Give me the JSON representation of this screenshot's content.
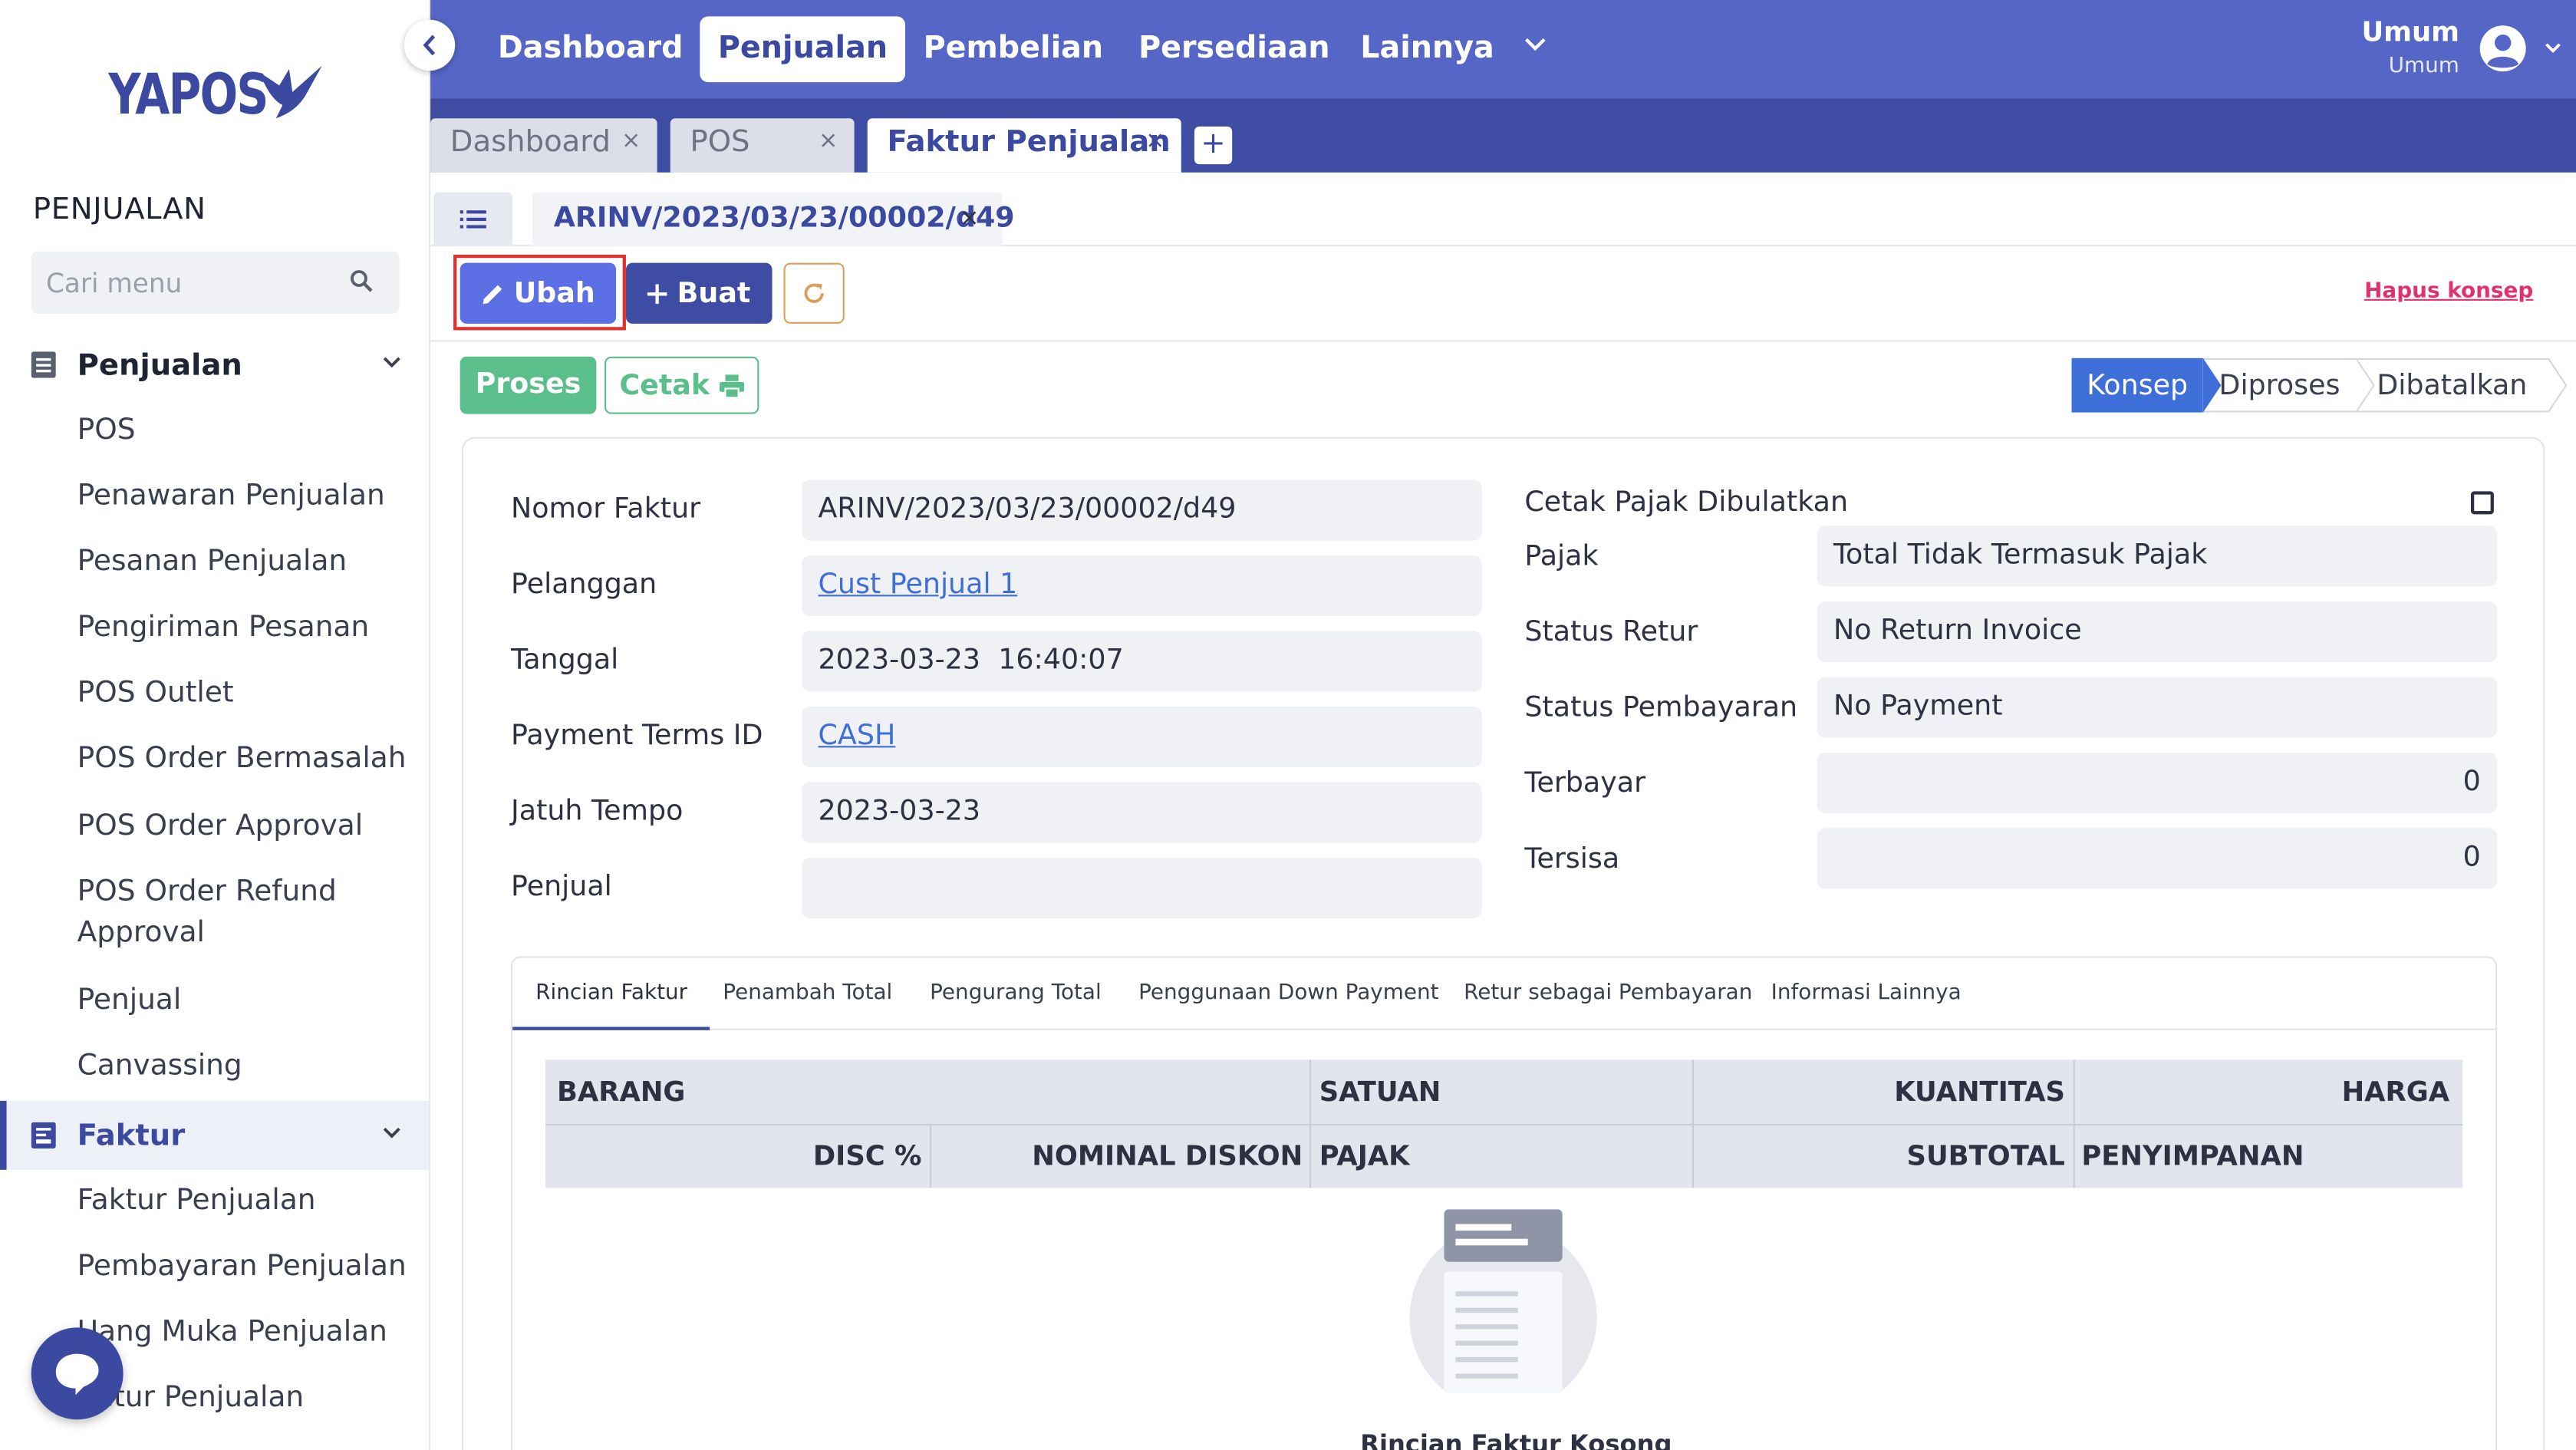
{
  "brand": {
    "name": "YAPOS"
  },
  "sidebar": {
    "section_title": "PENJUALAN",
    "search_placeholder": "Cari menu",
    "groups": [
      {
        "label": "Penjualan",
        "items": [
          "POS",
          "Penawaran Penjualan",
          "Pesanan Penjualan",
          "Pengiriman Pesanan",
          "POS Outlet",
          "POS Order Bermasalah",
          "POS Order Approval",
          "POS Order Refund Approval",
          "Penjual",
          "Canvassing"
        ]
      },
      {
        "label": "Faktur",
        "items": [
          "Faktur Penjualan",
          "Pembayaran Penjualan",
          "Uang Muka Penjualan",
          "Retur Penjualan"
        ]
      }
    ]
  },
  "topnav": {
    "items": [
      "Dashboard",
      "Penjualan",
      "Pembelian",
      "Persediaan",
      "Lainnya"
    ],
    "active": "Penjualan",
    "user": {
      "name": "Umum",
      "role": "Umum"
    }
  },
  "page_tabs": [
    {
      "label": "Dashboard",
      "close": "×"
    },
    {
      "label": "POS",
      "close": "×"
    },
    {
      "label": "Faktur Penjualan",
      "close": "×"
    }
  ],
  "tab_add": "+",
  "doc_tab": {
    "label": "ARINV/2023/03/23/00002/d49",
    "close": "×"
  },
  "toolbar": {
    "edit_label": "Ubah",
    "create_label": "Buat",
    "delete_draft_label": "Hapus konsep"
  },
  "actions": {
    "process_label": "Proses",
    "print_label": "Cetak"
  },
  "status_steps": [
    "Konsep",
    "Diproses",
    "Dibatalkan"
  ],
  "status_active": "Konsep",
  "form": {
    "left": [
      {
        "label": "Nomor Faktur",
        "value": "ARINV/2023/03/23/00002/d49"
      },
      {
        "label": "Pelanggan",
        "value": "Cust Penjual 1"
      },
      {
        "label": "Tanggal",
        "value": "2023-03-23  16:40:07"
      },
      {
        "label": "Payment Terms ID",
        "value": "CASH"
      },
      {
        "label": "Jatuh Tempo",
        "value": "2023-03-23"
      },
      {
        "label": "Penjual",
        "value": ""
      }
    ],
    "right": [
      {
        "label": "Cetak Pajak Dibulatkan",
        "checked": false
      },
      {
        "label": "Pajak",
        "value": "Total Tidak Termasuk Pajak"
      },
      {
        "label": "Status Retur",
        "value": "No Return Invoice"
      },
      {
        "label": "Status Pembayaran",
        "value": "No Payment"
      },
      {
        "label": "Terbayar",
        "value": "0"
      },
      {
        "label": "Tersisa",
        "value": "0"
      }
    ]
  },
  "detail_tabs": [
    "Rincian Faktur",
    "Penambah Total",
    "Pengurang Total",
    "Penggunaan Down Payment",
    "Retur sebagai Pembayaran",
    "Informasi Lainnya"
  ],
  "table": {
    "header_row1": [
      "BARANG",
      "SATUAN",
      "KUANTITAS",
      "HARGA"
    ],
    "header_row2": [
      "DISC %",
      "NOMINAL DISKON",
      "PAJAK",
      "SUBTOTAL",
      "PENYIMPANAN"
    ]
  },
  "empty_state": "Rincian Faktur Kosong",
  "colors": {
    "primary": "#3e4da3",
    "nav": "#5566c6",
    "edit_button": "#5c6fe5",
    "success": "#5bbf8c",
    "link": "#3e6fd8",
    "danger": "#e0336d",
    "highlight_frame": "#e0322d"
  }
}
